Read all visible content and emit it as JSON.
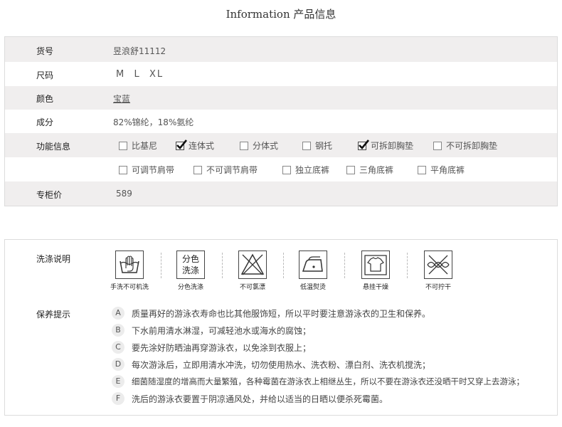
{
  "title": {
    "en": "Information",
    "zh": "产品信息"
  },
  "spec": {
    "item_no": {
      "label": "货号",
      "value": "昱浪舒11112"
    },
    "size": {
      "label": "尺码",
      "value": "M  L  XL"
    },
    "color": {
      "label": "颜色",
      "value": "宝蓝"
    },
    "composition": {
      "label": "成分",
      "value": "82%锦纶，18%氨纶"
    },
    "features": {
      "label": "功能信息",
      "row1": [
        {
          "text": "比基尼",
          "checked": false
        },
        {
          "text": "连体式",
          "checked": true
        },
        {
          "text": "分体式",
          "checked": false
        },
        {
          "text": "钢托",
          "checked": false
        },
        {
          "text": "可拆卸胸垫",
          "checked": true
        },
        {
          "text": "不可拆卸胸垫",
          "checked": false
        }
      ],
      "row2": [
        {
          "text": "可调节肩带",
          "checked": false
        },
        {
          "text": "不可调节肩带",
          "checked": false
        },
        {
          "text": "独立底裤",
          "checked": false
        },
        {
          "text": "三角底裤",
          "checked": false
        },
        {
          "text": "平角底裤",
          "checked": false
        }
      ]
    },
    "price": {
      "label": "专柜价",
      "value": "589"
    }
  },
  "care": {
    "wash_label": "洗涤说明",
    "wash_icon_text": [
      "分色",
      "洗涤"
    ],
    "wash_icons": [
      {
        "icon": "hand-wash-icon",
        "caption": "手洗不可机洗"
      },
      {
        "icon": "separate-wash-icon",
        "caption": "分色洗涤"
      },
      {
        "icon": "no-bleach-icon",
        "caption": "不可氯漂"
      },
      {
        "icon": "low-iron-icon",
        "caption": "低温熨烫"
      },
      {
        "icon": "hang-dry-icon",
        "caption": "悬挂干燥"
      },
      {
        "icon": "no-wring-icon",
        "caption": "不可拧干"
      }
    ],
    "tips_label": "保养提示",
    "tips": [
      {
        "letter": "A",
        "text": "质量再好的游泳衣寿命也比其他服饰短，所以平时要注意游泳衣的卫生和保养。"
      },
      {
        "letter": "B",
        "text": "下水前用清水淋湿，可减轻池水或海水的腐蚀；"
      },
      {
        "letter": "C",
        "text": "要先涂好防晒油再穿游泳衣，以免涂到衣服上；"
      },
      {
        "letter": "D",
        "text": "每次游泳后，立即用清水冲洗，切勿使用热水、洗衣粉、漂白剂、洗衣机搅洗；"
      },
      {
        "letter": "E",
        "text": "细菌随湿度的增高而大量繁殖，各种霉菌在游泳衣上相继丛生，所以不要在游泳衣还没晒干时又穿上去游泳；"
      },
      {
        "letter": "F",
        "text": "洗后的游泳衣要置于阴凉通风处，并给以适当的日晒以便杀死霉菌。"
      }
    ]
  }
}
